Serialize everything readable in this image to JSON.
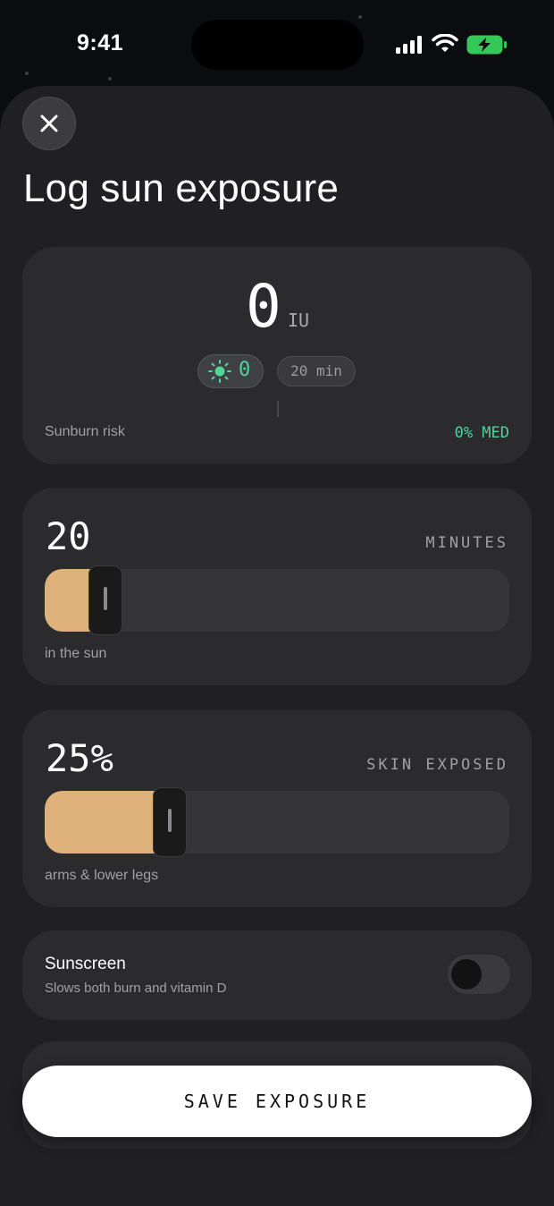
{
  "status_bar": {
    "time": "9:41"
  },
  "sheet": {
    "title": "Log sun exposure",
    "summary": {
      "iu_value": "0",
      "iu_unit": "IU",
      "sun_count": "0",
      "duration_pill": "20 min",
      "sunburn_label": "Sunburn risk",
      "sunburn_value": "0% MED",
      "accent_color": "#4fd49a"
    },
    "minutes": {
      "value": "20",
      "caption": "MINUTES",
      "subtitle": "in the sun",
      "slider_fraction": 0.05
    },
    "skin": {
      "value": "25%",
      "caption": "SKIN EXPOSED",
      "subtitle": "arms & lower legs",
      "slider_fraction": 0.2
    },
    "sunscreen": {
      "title": "Sunscreen",
      "description": "Slows both burn and vitamin D",
      "enabled": false
    },
    "save_label": "SAVE EXPOSURE",
    "fill_color": "#deb27a"
  }
}
